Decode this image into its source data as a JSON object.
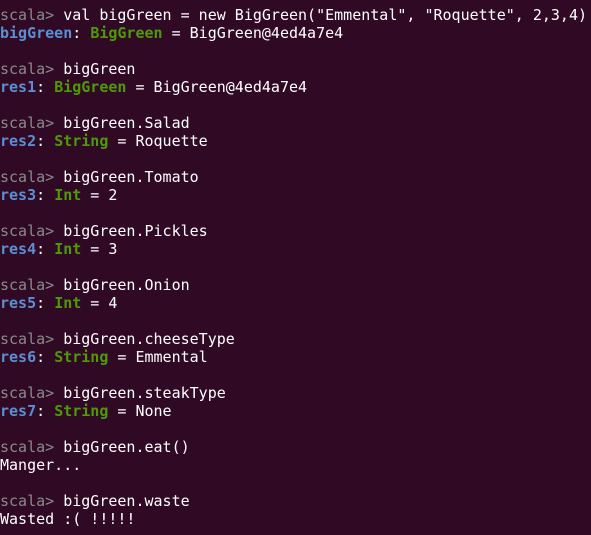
{
  "terminal": {
    "prompt": "scala>",
    "entries": [
      {
        "command": "val bigGreen = new BigGreen(\"Emmental\", \"Roquette\", 2,3,4)",
        "result": {
          "name": "bigGreen",
          "type": "BigGreen",
          "value": "BigGreen@4ed4a7e4"
        }
      },
      {
        "command": "bigGreen",
        "result": {
          "name": "res1",
          "type": "BigGreen",
          "value": "BigGreen@4ed4a7e4"
        }
      },
      {
        "command": "bigGreen.Salad",
        "result": {
          "name": "res2",
          "type": "String",
          "value": "Roquette"
        }
      },
      {
        "command": "bigGreen.Tomato",
        "result": {
          "name": "res3",
          "type": "Int",
          "value": "2"
        }
      },
      {
        "command": "bigGreen.Pickles",
        "result": {
          "name": "res4",
          "type": "Int",
          "value": "3"
        }
      },
      {
        "command": "bigGreen.Onion",
        "result": {
          "name": "res5",
          "type": "Int",
          "value": "4"
        }
      },
      {
        "command": "bigGreen.cheeseType",
        "result": {
          "name": "res6",
          "type": "String",
          "value": "Emmental"
        }
      },
      {
        "command": "bigGreen.steakType",
        "result": {
          "name": "res7",
          "type": "String",
          "value": "None"
        }
      },
      {
        "command": "bigGreen.eat()",
        "output": "Manger..."
      },
      {
        "command": "bigGreen.waste",
        "output": "Wasted :( !!!!!"
      }
    ]
  },
  "colors": {
    "background": "#300a24",
    "prompt": "#8a8a8a",
    "result_name": "#5c8fd1",
    "result_type": "#4e9a06",
    "text": "#ffffff"
  }
}
